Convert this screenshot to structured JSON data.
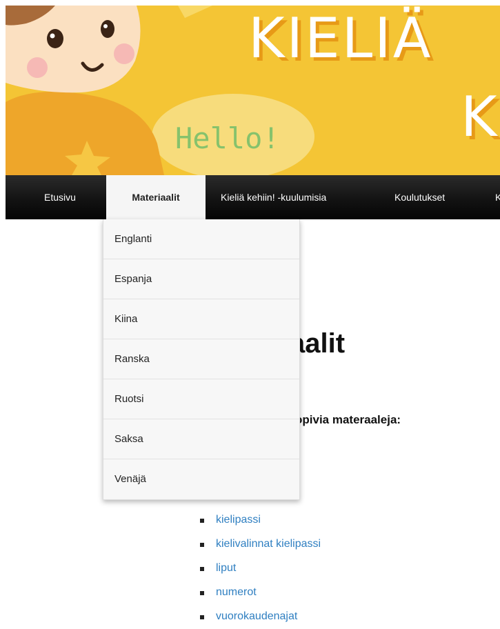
{
  "banner": {
    "title_line1": "KIELIÄ",
    "title_line2": "K",
    "speech_bubble": "Hello!"
  },
  "nav": {
    "items": [
      {
        "label": "Etusivu"
      },
      {
        "label": "Materiaalit"
      },
      {
        "label": "Kieliä kehiin! -kuulumisia"
      },
      {
        "label": "Koulutukset"
      },
      {
        "label": "K"
      }
    ]
  },
  "dropdown": {
    "items": [
      {
        "label": "Englanti"
      },
      {
        "label": "Espanja"
      },
      {
        "label": "Kiina"
      },
      {
        "label": "Ranska"
      },
      {
        "label": "Ruotsi"
      },
      {
        "label": "Saksa"
      },
      {
        "label": "Venäjä"
      }
    ]
  },
  "main": {
    "heading_visible": "aalit",
    "subheading_visible": "opivia materaaleja:",
    "links": [
      {
        "label": "kielipassi"
      },
      {
        "label": "kielivalinnat kielipassi"
      },
      {
        "label": "liput"
      },
      {
        "label": "numerot"
      },
      {
        "label": "vuorokaudenajat"
      }
    ]
  },
  "colors": {
    "banner_yellow": "#f4c535",
    "banner_shadow": "#e79a17",
    "hello_green": "#86c26c",
    "link_blue": "#2f7fc1",
    "nav_dark": "#111111",
    "nav_active_bg": "#f5f5f5"
  }
}
